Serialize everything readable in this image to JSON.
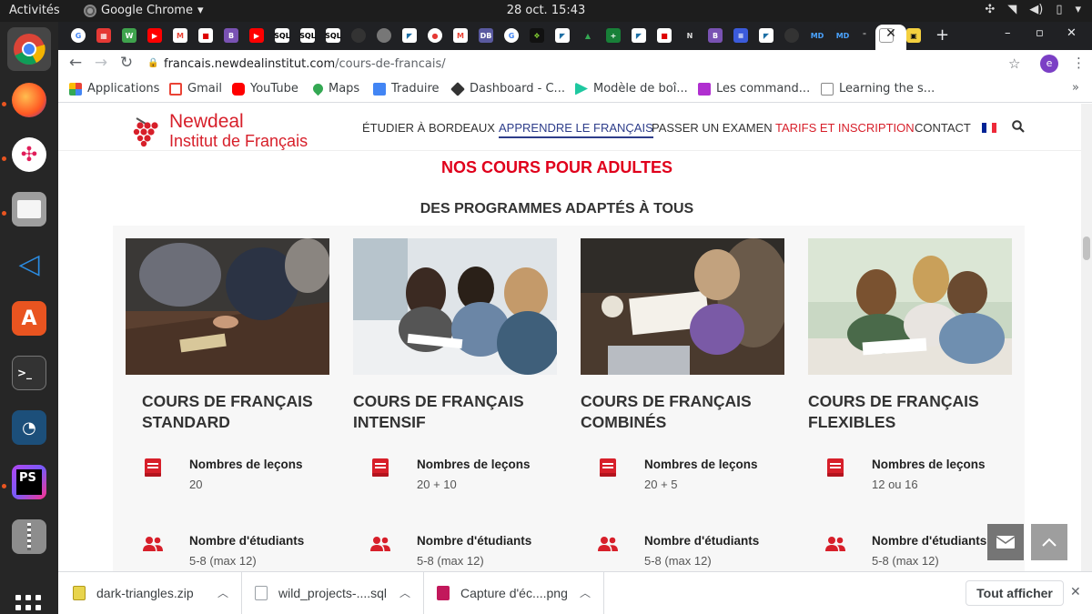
{
  "system": {
    "activities": "Activités",
    "app_name": "Google Chrome",
    "clock": "28 oct.  15:43"
  },
  "browser": {
    "url_host": "francais.newdealinstitut.com",
    "url_path": "/cours-de-francais/",
    "profile_initial": "e",
    "bookmarks": [
      {
        "label": "Applications",
        "color": "#4285f4"
      },
      {
        "label": "Gmail",
        "color": "#ea4335"
      },
      {
        "label": "YouTube",
        "color": "#ff0000"
      },
      {
        "label": "Maps",
        "color": "#34a853"
      },
      {
        "label": "Traduire",
        "color": "#4285f4"
      },
      {
        "label": "Dashboard - C...",
        "color": "#333333"
      },
      {
        "label": "Modèle de boî...",
        "color": "#1ec8a0"
      },
      {
        "label": "Les command...",
        "color": "#b02fd0"
      },
      {
        "label": "Learning the s...",
        "color": "#888888"
      }
    ]
  },
  "site": {
    "logo_line1": "Newdeal",
    "logo_line2": "Institut de Français",
    "nav": [
      "ÉTUDIER À BORDEAUX",
      "APPRENDRE LE FRANÇAIS",
      "PASSER UN EXAMEN",
      "TARIFS ET INSCRIPTION",
      "CONTACT"
    ],
    "heading": "NOS COURS POUR ADULTES",
    "subheading": "DES PROGRAMMES ADAPTÉS À TOUS",
    "brand_color": "#d71f2a",
    "cards": [
      {
        "title": "COURS DE FRANÇAIS STANDARD",
        "lessons_label": "Nombres de leçons",
        "lessons_value": "20",
        "students_label": "Nombre d'étudiants",
        "students_value": "5-8 (max 12)"
      },
      {
        "title": "COURS DE FRANÇAIS INTENSIF",
        "lessons_label": "Nombres de leçons",
        "lessons_value": "20 + 10",
        "students_label": "Nombre d'étudiants",
        "students_value": "5-8 (max 12)"
      },
      {
        "title": "COURS DE FRANÇAIS COMBINÉS",
        "lessons_label": "Nombres de leçons",
        "lessons_value": "20 + 5",
        "students_label": "Nombre d'étudiants",
        "students_value": "5-8 (max 12)"
      },
      {
        "title": "COURS DE FRANÇAIS FLEXIBLES",
        "lessons_label": "Nombres de leçons",
        "lessons_value": "12 ou 16",
        "students_label": "Nombre d'étudiants",
        "students_value": "5-8 (max 12)"
      }
    ]
  },
  "downloads": {
    "items": [
      {
        "name": "dark-triangles.zip",
        "color": "#e8d44d"
      },
      {
        "name": "wild_projects-....sql",
        "color": "#9aa0a6"
      },
      {
        "name": "Capture d'éc....png",
        "color": "#c2185b"
      }
    ],
    "show_all": "Tout afficher"
  }
}
